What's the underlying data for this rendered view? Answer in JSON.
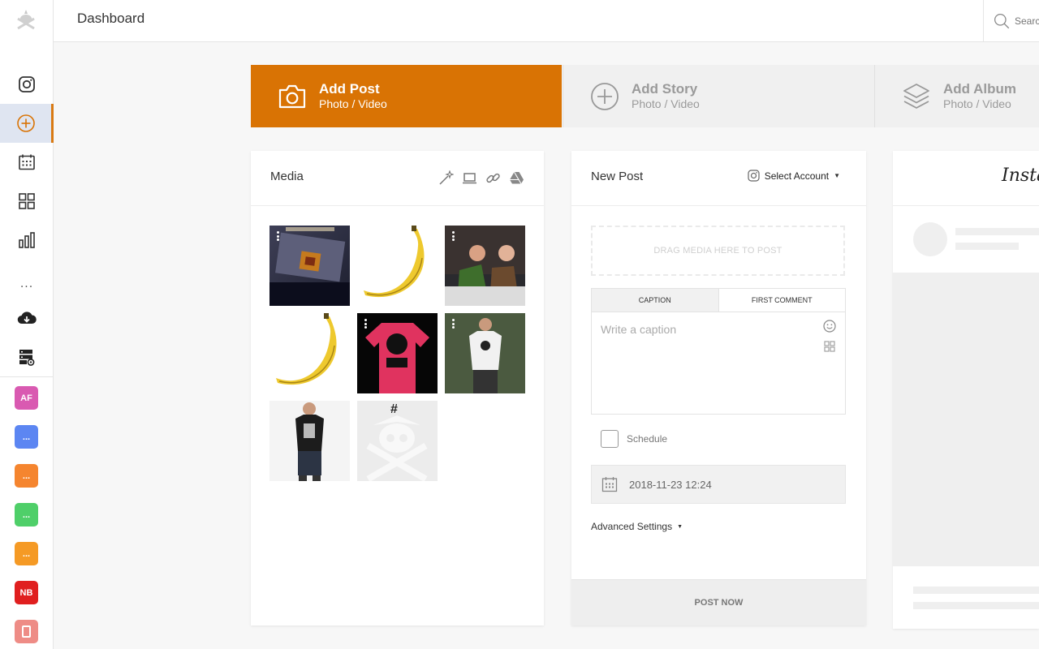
{
  "header": {
    "title": "Dashboard",
    "search_placeholder": "Search"
  },
  "sidebar": {
    "nav": [
      {
        "name": "instagram-icon"
      },
      {
        "name": "add-circle-icon",
        "active": true
      },
      {
        "name": "calendar-icon"
      },
      {
        "name": "grid-icon"
      },
      {
        "name": "bar-chart-icon"
      },
      {
        "name": "more-dots-icon"
      },
      {
        "name": "cloud-download-icon"
      },
      {
        "name": "server-settings-icon"
      }
    ],
    "more_label": "...",
    "accounts": [
      {
        "label": "AF",
        "color": "#d95ab1"
      },
      {
        "label": "...",
        "color": "#5c86f2"
      },
      {
        "label": "...",
        "color": "#f5852f"
      },
      {
        "label": "...",
        "color": "#4fcf69"
      },
      {
        "label": "...",
        "color": "#f59a25"
      },
      {
        "label": "NB",
        "color": "#e01f1f"
      },
      {
        "label": "",
        "color": "#ee8c86"
      }
    ]
  },
  "tabs": [
    {
      "title": "Add Post",
      "subtitle": "Photo / Video",
      "active": true
    },
    {
      "title": "Add Story",
      "subtitle": "Photo / Video",
      "active": false
    },
    {
      "title": "Add Album",
      "subtitle": "Photo / Video",
      "active": false
    }
  ],
  "media": {
    "title": "Media",
    "tools": [
      "magic-wand-icon",
      "laptop-icon",
      "link-icon",
      "google-drive-icon"
    ],
    "thumbs": [
      {
        "name": "media-thumb-poster"
      },
      {
        "name": "media-thumb-banana"
      },
      {
        "name": "media-thumb-couple"
      },
      {
        "name": "media-thumb-banana-2"
      },
      {
        "name": "media-thumb-red-tshirt"
      },
      {
        "name": "media-thumb-white-tshirt"
      },
      {
        "name": "media-thumb-black-tshirt"
      },
      {
        "name": "media-thumb-pirate-logo",
        "text": "#"
      }
    ]
  },
  "new_post": {
    "title": "New Post",
    "select_account": "Select Account",
    "drop_zone": "DRAG MEDIA HERE TO POST",
    "caption_tab": "CAPTION",
    "first_comment_tab": "FIRST COMMENT",
    "caption_placeholder": "Write a caption",
    "schedule_label": "Schedule",
    "date": "2018-11-23 12:24",
    "advanced": "Advanced Settings",
    "post_now": "POST NOW"
  },
  "preview": {
    "brand": "Instagram"
  },
  "colors": {
    "accent": "#d97304",
    "sidebar_active": "#dfe5f1"
  }
}
